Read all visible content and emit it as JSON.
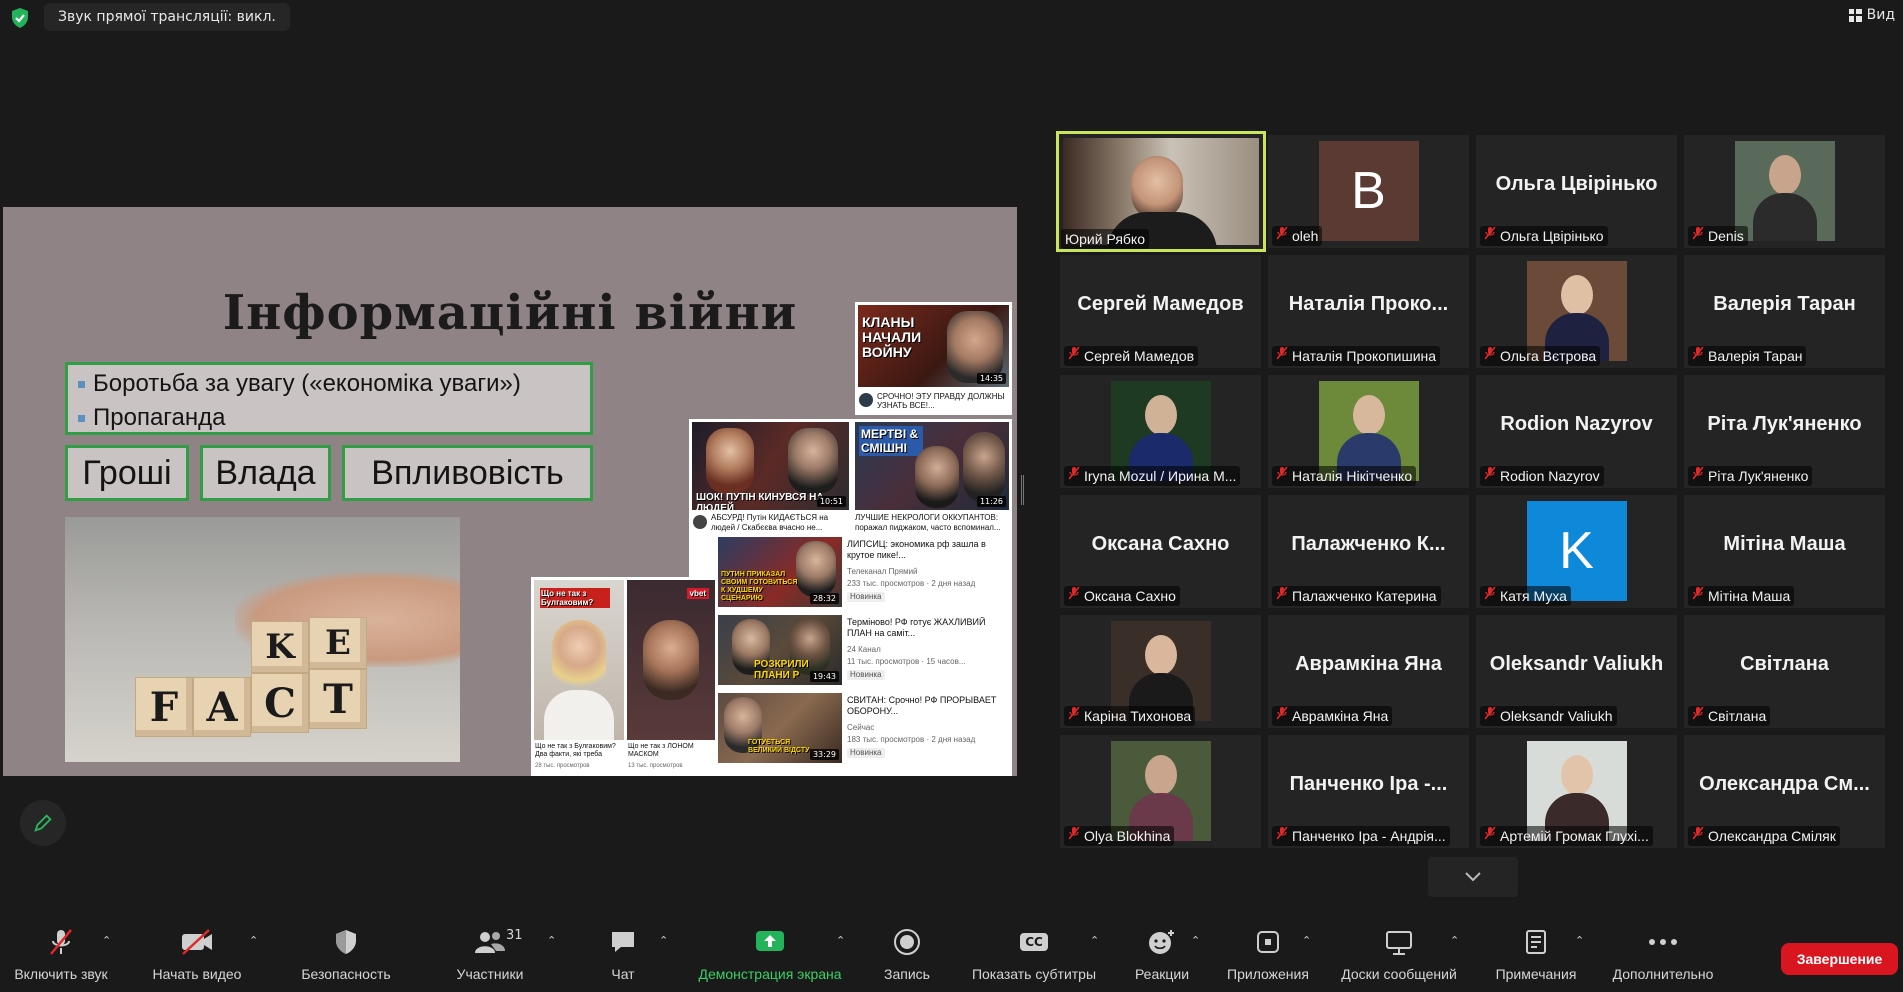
{
  "topbar": {
    "stream_audio_label": "Звук прямої трансляції: викл.",
    "view_label": "Вид"
  },
  "slide": {
    "title": "Інформаційні війни",
    "bullets": [
      "Боротьба за увагу («економіка уваги»)",
      "Пропаганда"
    ],
    "keywords": [
      "Гроші",
      "Влада",
      "Впливовість"
    ],
    "fact_letters": [
      "F",
      "A",
      "C",
      "T",
      "K",
      "E"
    ],
    "yt": {
      "v1_caption": "КЛАНЫ НАЧАЛИ ВОЙНУ",
      "v1_duration": "14:35",
      "v1_title": "СРОЧНО! ЭТУ ПРАВДУ ДОЛЖНЫ УЗНАТЬ ВСЕ!...",
      "v2_caption": "ШОК! ПУТІН КИНУВСЯ НА ЛЮДЕЙ",
      "v2_duration": "10:51",
      "v2_title": "АБСУРД! Путін КИДАЄТЬСЯ на людей / Скабєєва вчасно не...",
      "v3_caption": "МЕРТВІ & СМІШНІ",
      "v3_duration": "11:26",
      "v3_title": "ЛУЧШИЕ НЕКРОЛОГИ ОККУПАНТОВ: поражал пиджаком, часто вспоминал...",
      "v4_caption": "ПУТИН ПРИКАЗАЛ СВОИМ ГОТОВИТЬСЯ К ХУДШЕМУ СЦЕНАРИЮ",
      "v4_duration": "28:32",
      "v4_title": "ЛИПСИЦ: экономика рф зашла в крутое пике!...",
      "v4_channel": "Телеканал Прямий",
      "v4_meta": "233 тыс. просмотров · 2 дня назад",
      "v4_badge": "Новинка",
      "v5_caption": "РОЗКРИЛИ ПЛАНИ Р",
      "v5_duration": "19:43",
      "v5_title": "Терміново! РФ готує ЖАХЛИВИЙ ПЛАН на саміт...",
      "v5_channel": "24 Канал",
      "v5_meta": "11 тыс. просмотров · 15 часов...",
      "v5_badge": "Новинка",
      "v6_caption": "ГОТУЄТЬСЯ ВЕЛИКИЙ ВІДСТУ",
      "v6_duration": "33:29",
      "v6_title": "СВИТАН: Срочно! РФ ПРОРЫВАЕТ ОБОРОНУ...",
      "v6_channel": "Сейчас",
      "v6_meta": "183 тыс. просмотров · 2 дня назад",
      "v6_badge": "Новинка",
      "s1_caption": "Що не так з Булгаковим?",
      "s1_title": "Що не так з Булгаковим? Два факти, які треба варт...",
      "s1_meta": "28 тыс. просмотров",
      "s2_caption": "vbet",
      "s2_title": "Що не так з ЛОНОМ МАСКОМ",
      "s2_meta": "13 тыс. просмотров"
    }
  },
  "participants": [
    {
      "name": "Юрий Рябко",
      "label": "Юрий Рябко",
      "type": "video",
      "muted": false,
      "active": true
    },
    {
      "name": "oleh",
      "label": "oleh",
      "type": "letter",
      "letter": "B",
      "color": "#5b3a33",
      "muted": true
    },
    {
      "name": "Ольга Цвірінько",
      "label": "Ольга Цвірінько",
      "type": "name",
      "muted": true
    },
    {
      "name": "Denis",
      "label": "Denis",
      "type": "photo",
      "muted": true
    },
    {
      "name": "Сергей Мамедов",
      "label": "Сергей Мамедов",
      "type": "name",
      "muted": true
    },
    {
      "name": "Наталія Проко...",
      "label": "Наталія Прокопишина",
      "type": "name",
      "muted": true
    },
    {
      "name": "Ольга Вєтрова",
      "label": "Ольга Вєтрова",
      "type": "photo",
      "muted": true
    },
    {
      "name": "Валерія Таран",
      "label": "Валерія Таран",
      "type": "name",
      "muted": true
    },
    {
      "name": "Iryna Mozul",
      "label": "Iryna Mozul / Ирина М...",
      "type": "photo",
      "muted": true
    },
    {
      "name": "Наталія Нікітченко",
      "label": "Наталія Нікітченко",
      "type": "photo",
      "muted": true
    },
    {
      "name": "Rodion Nazyrov",
      "label": "Rodion Nazyrov",
      "type": "name",
      "muted": true
    },
    {
      "name": "Ріта Лук'яненко",
      "label": "Ріта Лук'яненко",
      "type": "name",
      "muted": true
    },
    {
      "name": "Оксана Сахно",
      "label": "Оксана Сахно",
      "type": "name",
      "muted": true
    },
    {
      "name": "Палажченко К...",
      "label": "Палажченко Катерина",
      "type": "name",
      "muted": true
    },
    {
      "name": "Катя Муха",
      "label": "Катя Муха",
      "type": "letter",
      "letter": "K",
      "color": "#0e88d8",
      "muted": true
    },
    {
      "name": "Мітіна Маша",
      "label": "Мітіна Маша",
      "type": "name",
      "muted": true
    },
    {
      "name": "Каріна Тихонова",
      "label": "Каріна Тихонова",
      "type": "photo",
      "muted": true
    },
    {
      "name": "Аврамкіна Яна",
      "label": "Аврамкіна Яна",
      "type": "name",
      "muted": true
    },
    {
      "name": "Oleksandr Valiukh",
      "label": "Oleksandr Valiukh",
      "type": "name",
      "muted": true
    },
    {
      "name": "Світлана",
      "label": "Світлана",
      "type": "name",
      "muted": true
    },
    {
      "name": "Olya Blokhina",
      "label": "Olya Blokhina",
      "type": "photo",
      "muted": true
    },
    {
      "name": "Панченко Іра -...",
      "label": "Панченко Іра - Андрія...",
      "type": "name",
      "muted": true
    },
    {
      "name": "Артемій Громак",
      "label": "Артемій Громак Глухі...",
      "type": "photo",
      "muted": true
    },
    {
      "name": "Олександра См...",
      "label": "Олександра Сміляк",
      "type": "name",
      "muted": true
    }
  ],
  "toolbar": {
    "unmute": "Включить звук",
    "start_video": "Начать видео",
    "security": "Безопасность",
    "participants": "Участники",
    "participants_count": "31",
    "chat": "Чат",
    "share": "Демонстрация экрана",
    "record": "Запись",
    "captions": "Показать субтитры",
    "captions_badge": "CC",
    "reactions": "Реакции",
    "apps": "Приложения",
    "whiteboards": "Доски сообщений",
    "notes": "Примечания",
    "more": "Дополнительно",
    "end": "Завершение"
  },
  "colors": {
    "active_speaker_border": "#c8e659",
    "muted_icon": "#e02828",
    "share_green": "#3ccf66",
    "end_red": "#d9161f"
  }
}
